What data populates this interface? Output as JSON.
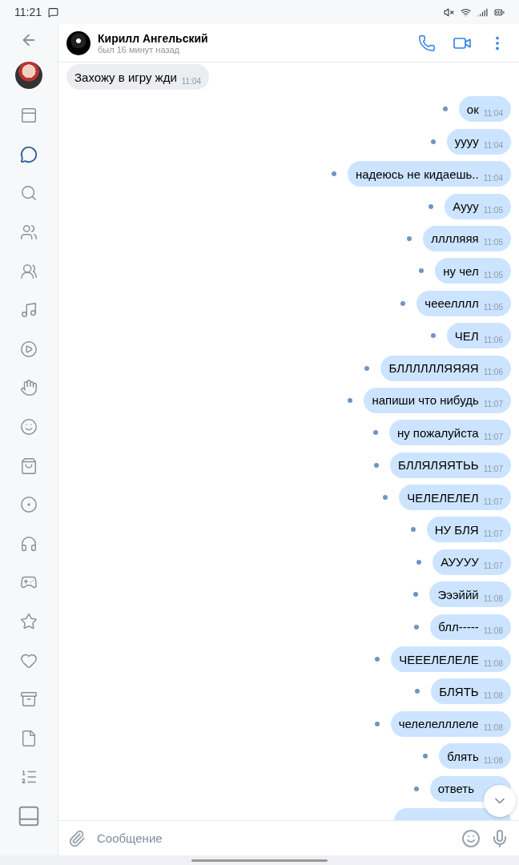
{
  "status_bar": {
    "time": "11:21"
  },
  "sidebar": {
    "items": [
      {
        "selected": false
      },
      {
        "selected": true
      },
      {
        "selected": false
      },
      {
        "selected": false
      },
      {
        "selected": false
      },
      {
        "selected": false
      },
      {
        "selected": false
      },
      {
        "selected": false
      },
      {
        "selected": false
      },
      {
        "selected": false
      },
      {
        "selected": false
      },
      {
        "selected": false
      },
      {
        "selected": false
      },
      {
        "selected": false
      },
      {
        "selected": false
      },
      {
        "selected": false
      },
      {
        "selected": false
      },
      {
        "selected": false
      }
    ]
  },
  "header": {
    "name": "Кирилл Ангельский",
    "status": "был 16 минут назад"
  },
  "messages": [
    {
      "kind": "incoming",
      "text": "Захожу в игру жди",
      "time": "11:04"
    },
    {
      "kind": "outgoing",
      "text": "ок",
      "time": "11:04",
      "unread": true
    },
    {
      "kind": "outgoing",
      "text": "уууу",
      "time": "11:04",
      "unread": true
    },
    {
      "kind": "outgoing",
      "text": "надеюсь не кидаешь..",
      "time": "11:04",
      "unread": true
    },
    {
      "kind": "outgoing",
      "text": "Аууу",
      "time": "11:05",
      "unread": true
    },
    {
      "kind": "outgoing",
      "text": "лллляяя",
      "time": "11:05",
      "unread": true
    },
    {
      "kind": "outgoing",
      "text": "ну чел",
      "time": "11:05",
      "unread": true
    },
    {
      "kind": "outgoing",
      "text": "чееелллл",
      "time": "11:05",
      "unread": true
    },
    {
      "kind": "outgoing",
      "text": "ЧЕЛ",
      "time": "11:06",
      "unread": true
    },
    {
      "kind": "outgoing",
      "text": "БЛЛЛЛЛЛЯЯЯЯ",
      "time": "11:06",
      "unread": true
    },
    {
      "kind": "outgoing",
      "text": "напиши что нибудь",
      "time": "11:07",
      "unread": true
    },
    {
      "kind": "outgoing",
      "text": "ну пожалуйста",
      "time": "11:07",
      "unread": true
    },
    {
      "kind": "outgoing",
      "text": "БЛЛЯЛЯЯТЬЬ",
      "time": "11:07",
      "unread": true
    },
    {
      "kind": "outgoing",
      "text": "ЧЕЛЕЛЕЛЕЛ",
      "time": "11:07",
      "unread": true
    },
    {
      "kind": "outgoing",
      "text": "НУ БЛЯ",
      "time": "11:07",
      "unread": true
    },
    {
      "kind": "outgoing",
      "text": "АУУУУ",
      "time": "11:07",
      "unread": true
    },
    {
      "kind": "outgoing",
      "text": "Эээййй",
      "time": "11:08",
      "unread": true
    },
    {
      "kind": "outgoing",
      "text": "блл-----",
      "time": "11:08",
      "unread": true
    },
    {
      "kind": "outgoing",
      "text": "ЧЕЕЕЛЕЛЕЛЕ",
      "time": "11:08",
      "unread": true
    },
    {
      "kind": "outgoing",
      "text": "БЛЯТЬ",
      "time": "11:08",
      "unread": true
    },
    {
      "kind": "outgoing",
      "text": "челелелллеле",
      "time": "11:08",
      "unread": true
    },
    {
      "kind": "outgoing",
      "text": "блять",
      "time": "11:08",
      "unread": true
    },
    {
      "kind": "outgoing",
      "text": "ответь",
      "unread": true
    },
    {
      "kind": "clipped"
    }
  ],
  "composer": {
    "placeholder": "Сообщение"
  }
}
